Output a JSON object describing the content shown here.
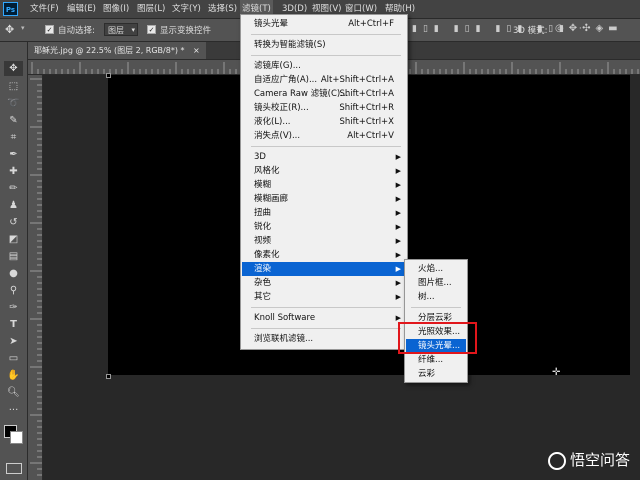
{
  "menubar": {
    "logo": "Ps",
    "items": [
      "文件(F)",
      "编辑(E)",
      "图像(I)",
      "图层(L)",
      "文字(Y)",
      "选择(S)",
      "滤镜(T)",
      "3D(D)",
      "视图(V)",
      "窗口(W)",
      "帮助(H)"
    ],
    "active_index": 6
  },
  "options": {
    "auto_select_label": "自动选择:",
    "auto_select_value": "图层",
    "show_transform_label": "显示变换控件",
    "mode_3d_label": "3D 模式:"
  },
  "document_tab": {
    "title": "耶稣光.jpg @ 22.5% (图层 2, RGB/8*) *",
    "close": "×"
  },
  "filter_menu": {
    "items": [
      {
        "label": "镜头光晕",
        "shortcut": "Alt+Ctrl+F"
      },
      {
        "sep": true
      },
      {
        "label": "转换为智能滤镜(S)"
      },
      {
        "sep": true
      },
      {
        "label": "滤镜库(G)..."
      },
      {
        "label": "自适应广角(A)...",
        "shortcut": "Alt+Shift+Ctrl+A"
      },
      {
        "label": "Camera Raw 滤镜(C)...",
        "shortcut": "Shift+Ctrl+A"
      },
      {
        "label": "镜头校正(R)...",
        "shortcut": "Shift+Ctrl+R"
      },
      {
        "label": "液化(L)...",
        "shortcut": "Shift+Ctrl+X"
      },
      {
        "label": "消失点(V)...",
        "shortcut": "Alt+Ctrl+V"
      },
      {
        "sep": true
      },
      {
        "label": "3D",
        "submenu": true
      },
      {
        "label": "风格化",
        "submenu": true
      },
      {
        "label": "模糊",
        "submenu": true
      },
      {
        "label": "模糊画廊",
        "submenu": true
      },
      {
        "label": "扭曲",
        "submenu": true
      },
      {
        "label": "锐化",
        "submenu": true
      },
      {
        "label": "视频",
        "submenu": true
      },
      {
        "label": "像素化",
        "submenu": true
      },
      {
        "label": "渲染",
        "submenu": true,
        "highlighted": true
      },
      {
        "label": "杂色",
        "submenu": true
      },
      {
        "label": "其它",
        "submenu": true
      },
      {
        "sep": true
      },
      {
        "label": "Knoll Software",
        "submenu": true
      },
      {
        "sep": true
      },
      {
        "label": "浏览联机滤镜..."
      }
    ]
  },
  "render_submenu": {
    "items": [
      {
        "label": "火焰..."
      },
      {
        "label": "图片框..."
      },
      {
        "label": "树..."
      },
      {
        "sep": true
      },
      {
        "label": "分层云彩"
      },
      {
        "label": "光照效果..."
      },
      {
        "label": "镜头光晕...",
        "highlighted": true
      },
      {
        "label": "纤维..."
      },
      {
        "label": "云彩"
      }
    ]
  },
  "watermark": {
    "text": "悟空问答"
  },
  "colors": {
    "highlight": "#0a64d2",
    "annotation_box": "#e1161b"
  }
}
